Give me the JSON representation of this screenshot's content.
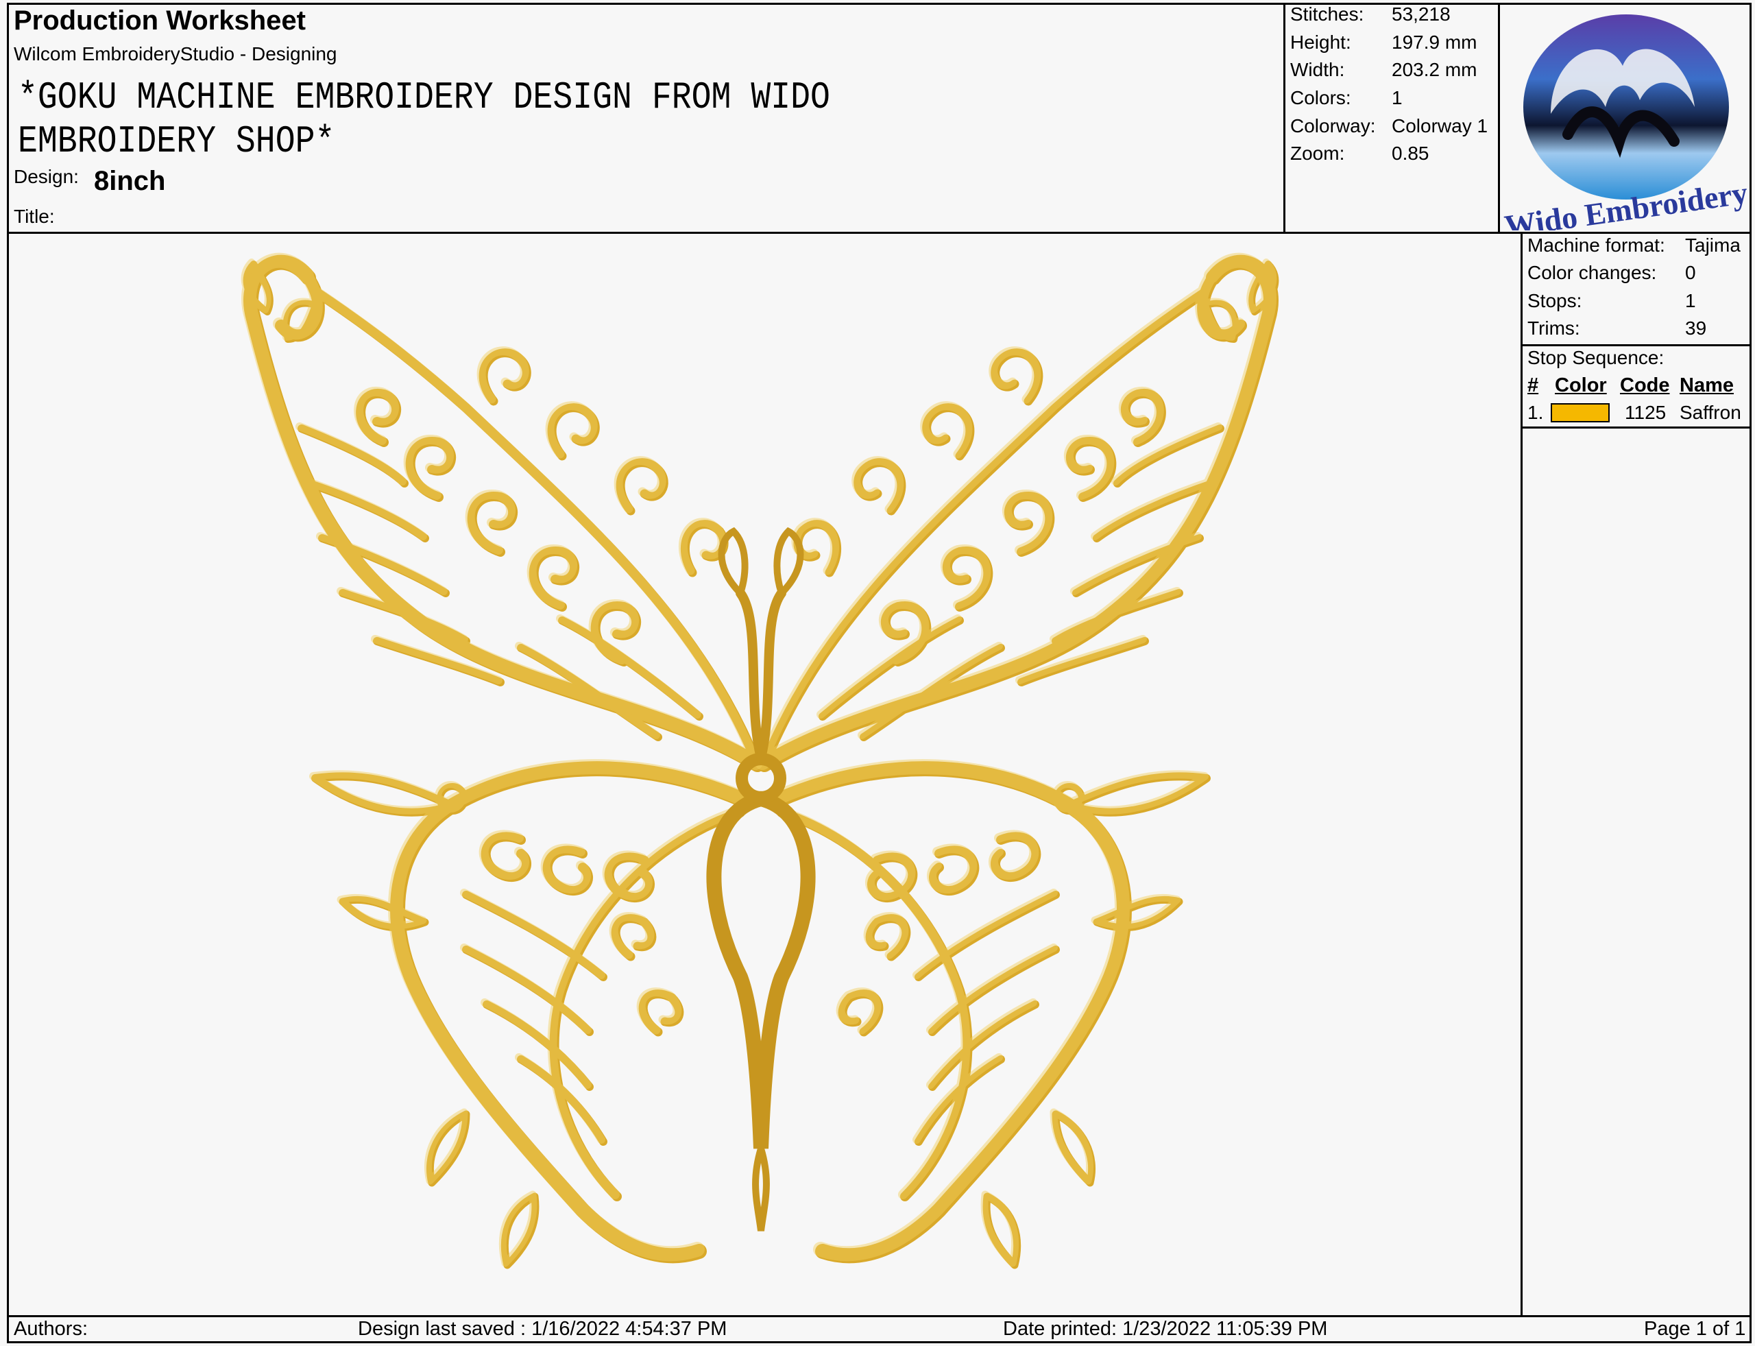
{
  "header": {
    "title": "Production Worksheet",
    "software": "Wilcom EmbroideryStudio - Designing",
    "design_name": "*GOKU MACHINE EMBROIDERY DESIGN FROM WIDO EMBROIDERY SHOP*",
    "design_label": "Design:",
    "design_value": "8inch",
    "title_label": "Title:"
  },
  "stats": [
    {
      "label": "Stitches:",
      "value": "53,218"
    },
    {
      "label": "Height:",
      "value": "197.9 mm"
    },
    {
      "label": "Width:",
      "value": "203.2 mm"
    },
    {
      "label": "Colors:",
      "value": "1"
    },
    {
      "label": "Colorway:",
      "value": "Colorway 1"
    },
    {
      "label": "Zoom:",
      "value": "0.85"
    }
  ],
  "logo": {
    "text": "Wido Embroidery"
  },
  "machine": [
    {
      "label": "Machine format:",
      "value": "Tajima"
    },
    {
      "label": "Color changes:",
      "value": "0"
    },
    {
      "label": "Stops:",
      "value": "1"
    },
    {
      "label": "Trims:",
      "value": "39"
    }
  ],
  "stop_sequence": {
    "title": "Stop Sequence:",
    "headers": [
      "#",
      "Color",
      "Code",
      "Name"
    ],
    "rows": [
      {
        "num": "1.",
        "color": "#f5b800",
        "code": "1125",
        "name": "Saffron"
      }
    ]
  },
  "footer": {
    "authors": "Authors:",
    "last_saved": "Design last saved : 1/16/2022 4:54:37 PM",
    "printed": "Date printed: 1/23/2022 11:05:39 PM",
    "page": "Page 1 of 1"
  },
  "colors": {
    "thread": "#d9a92a",
    "thread_dark": "#b8871a",
    "thread_light": "#f2cf5c"
  }
}
